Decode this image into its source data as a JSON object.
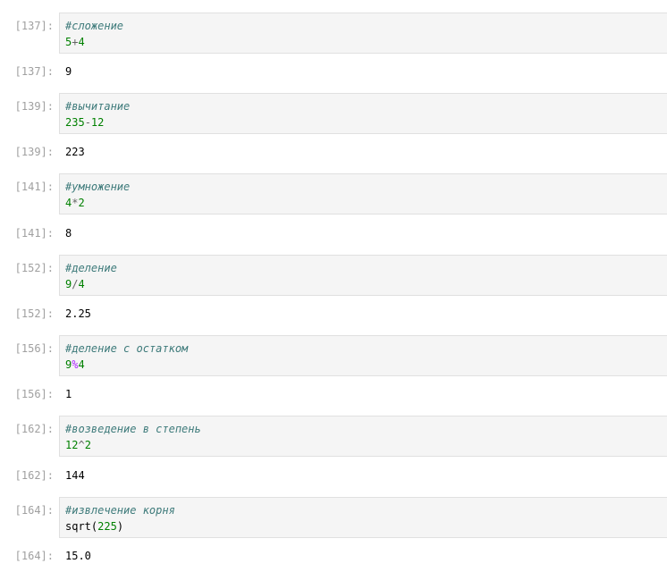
{
  "cells": [
    {
      "prompt_in": "[137]:",
      "comment": "#сложение",
      "code": [
        "5",
        "+",
        "4"
      ],
      "prompt_out": "[137]:",
      "output": "9"
    },
    {
      "prompt_in": "[139]:",
      "comment": "#вычитание",
      "code": [
        "235",
        "-",
        "12"
      ],
      "prompt_out": "[139]:",
      "output": "223"
    },
    {
      "prompt_in": "[141]:",
      "comment": "#умножение",
      "code": [
        "4",
        "*",
        "2"
      ],
      "prompt_out": "[141]:",
      "output": "8"
    },
    {
      "prompt_in": "[152]:",
      "comment": "#деление",
      "code": [
        "9",
        "/",
        "4"
      ],
      "prompt_out": "[152]:",
      "output": "2.25"
    },
    {
      "prompt_in": "[156]:",
      "comment": "#деление с остатком",
      "code": [
        "9",
        "%",
        "4"
      ],
      "prompt_out": "[156]:",
      "output": "1"
    },
    {
      "prompt_in": "[162]:",
      "comment": "#возведение в степень",
      "code": [
        "12",
        "^",
        "2"
      ],
      "prompt_out": "[162]:",
      "output": "144"
    },
    {
      "prompt_in": "[164]:",
      "comment": "#извлечение корня",
      "code": [
        "sqrt",
        "(",
        "225",
        ")"
      ],
      "prompt_out": "[164]:",
      "output": "15.0"
    }
  ],
  "colors": {
    "prompt": "#a0a0a0",
    "comment": "#3d7a7a",
    "number": "#008000",
    "operator": "#666666",
    "modulo": "#aa22ff",
    "input_background": "#f5f5f5",
    "input_border": "#e0e0e0"
  }
}
